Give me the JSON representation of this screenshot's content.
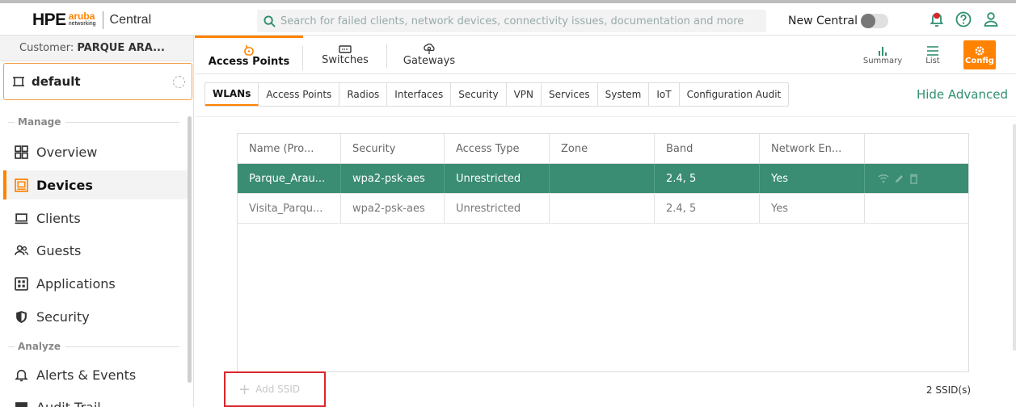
{
  "header": {
    "brand_hpe": "HPE",
    "brand_aruba": "aruba",
    "brand_networking": "networking",
    "app_name": "Central",
    "search_placeholder": "Search for failed clients, network devices, connectivity issues, documentation and more",
    "new_central_label": "New Central",
    "new_central_enabled": false
  },
  "sidebar": {
    "customer_label": "Customer:",
    "customer_name": "PARQUE ARA...",
    "scope": "default",
    "sections": [
      {
        "label": "Manage"
      },
      {
        "label": "Analyze"
      }
    ],
    "items": [
      {
        "label": "Overview"
      },
      {
        "label": "Devices"
      },
      {
        "label": "Clients"
      },
      {
        "label": "Guests"
      },
      {
        "label": "Applications"
      },
      {
        "label": "Security"
      },
      {
        "label": "Alerts & Events"
      },
      {
        "label": "Audit Trail"
      }
    ]
  },
  "device_tabs": [
    {
      "label": "Access Points"
    },
    {
      "label": "Switches"
    },
    {
      "label": "Gateways"
    }
  ],
  "view_buttons": {
    "summary": "Summary",
    "list": "List",
    "config": "Config"
  },
  "sub_tabs": [
    {
      "label": "WLANs"
    },
    {
      "label": "Access Points"
    },
    {
      "label": "Radios"
    },
    {
      "label": "Interfaces"
    },
    {
      "label": "Security"
    },
    {
      "label": "VPN"
    },
    {
      "label": "Services"
    },
    {
      "label": "System"
    },
    {
      "label": "IoT"
    },
    {
      "label": "Configuration Audit"
    }
  ],
  "hide_advanced": "Hide Advanced",
  "table": {
    "columns": [
      "Name (Pro...",
      "Security",
      "Access Type",
      "Zone",
      "Band",
      "Network En..."
    ],
    "rows": [
      {
        "name": "Parque_Arau...",
        "security": "wpa2-psk-aes",
        "access": "Unrestricted",
        "zone": "",
        "band": "2.4, 5",
        "network": "Yes"
      },
      {
        "name": "Visita_Parqu...",
        "security": "wpa2-psk-aes",
        "access": "Unrestricted",
        "zone": "",
        "band": "2.4, 5",
        "network": "Yes"
      }
    ]
  },
  "add_ssid": "Add SSID",
  "ssid_count": "2 SSID(s)",
  "colors": {
    "accent": "#ff8300",
    "selected_row": "#3a8c72",
    "link": "#2f8f72",
    "highlight_box": "#d9262c"
  }
}
